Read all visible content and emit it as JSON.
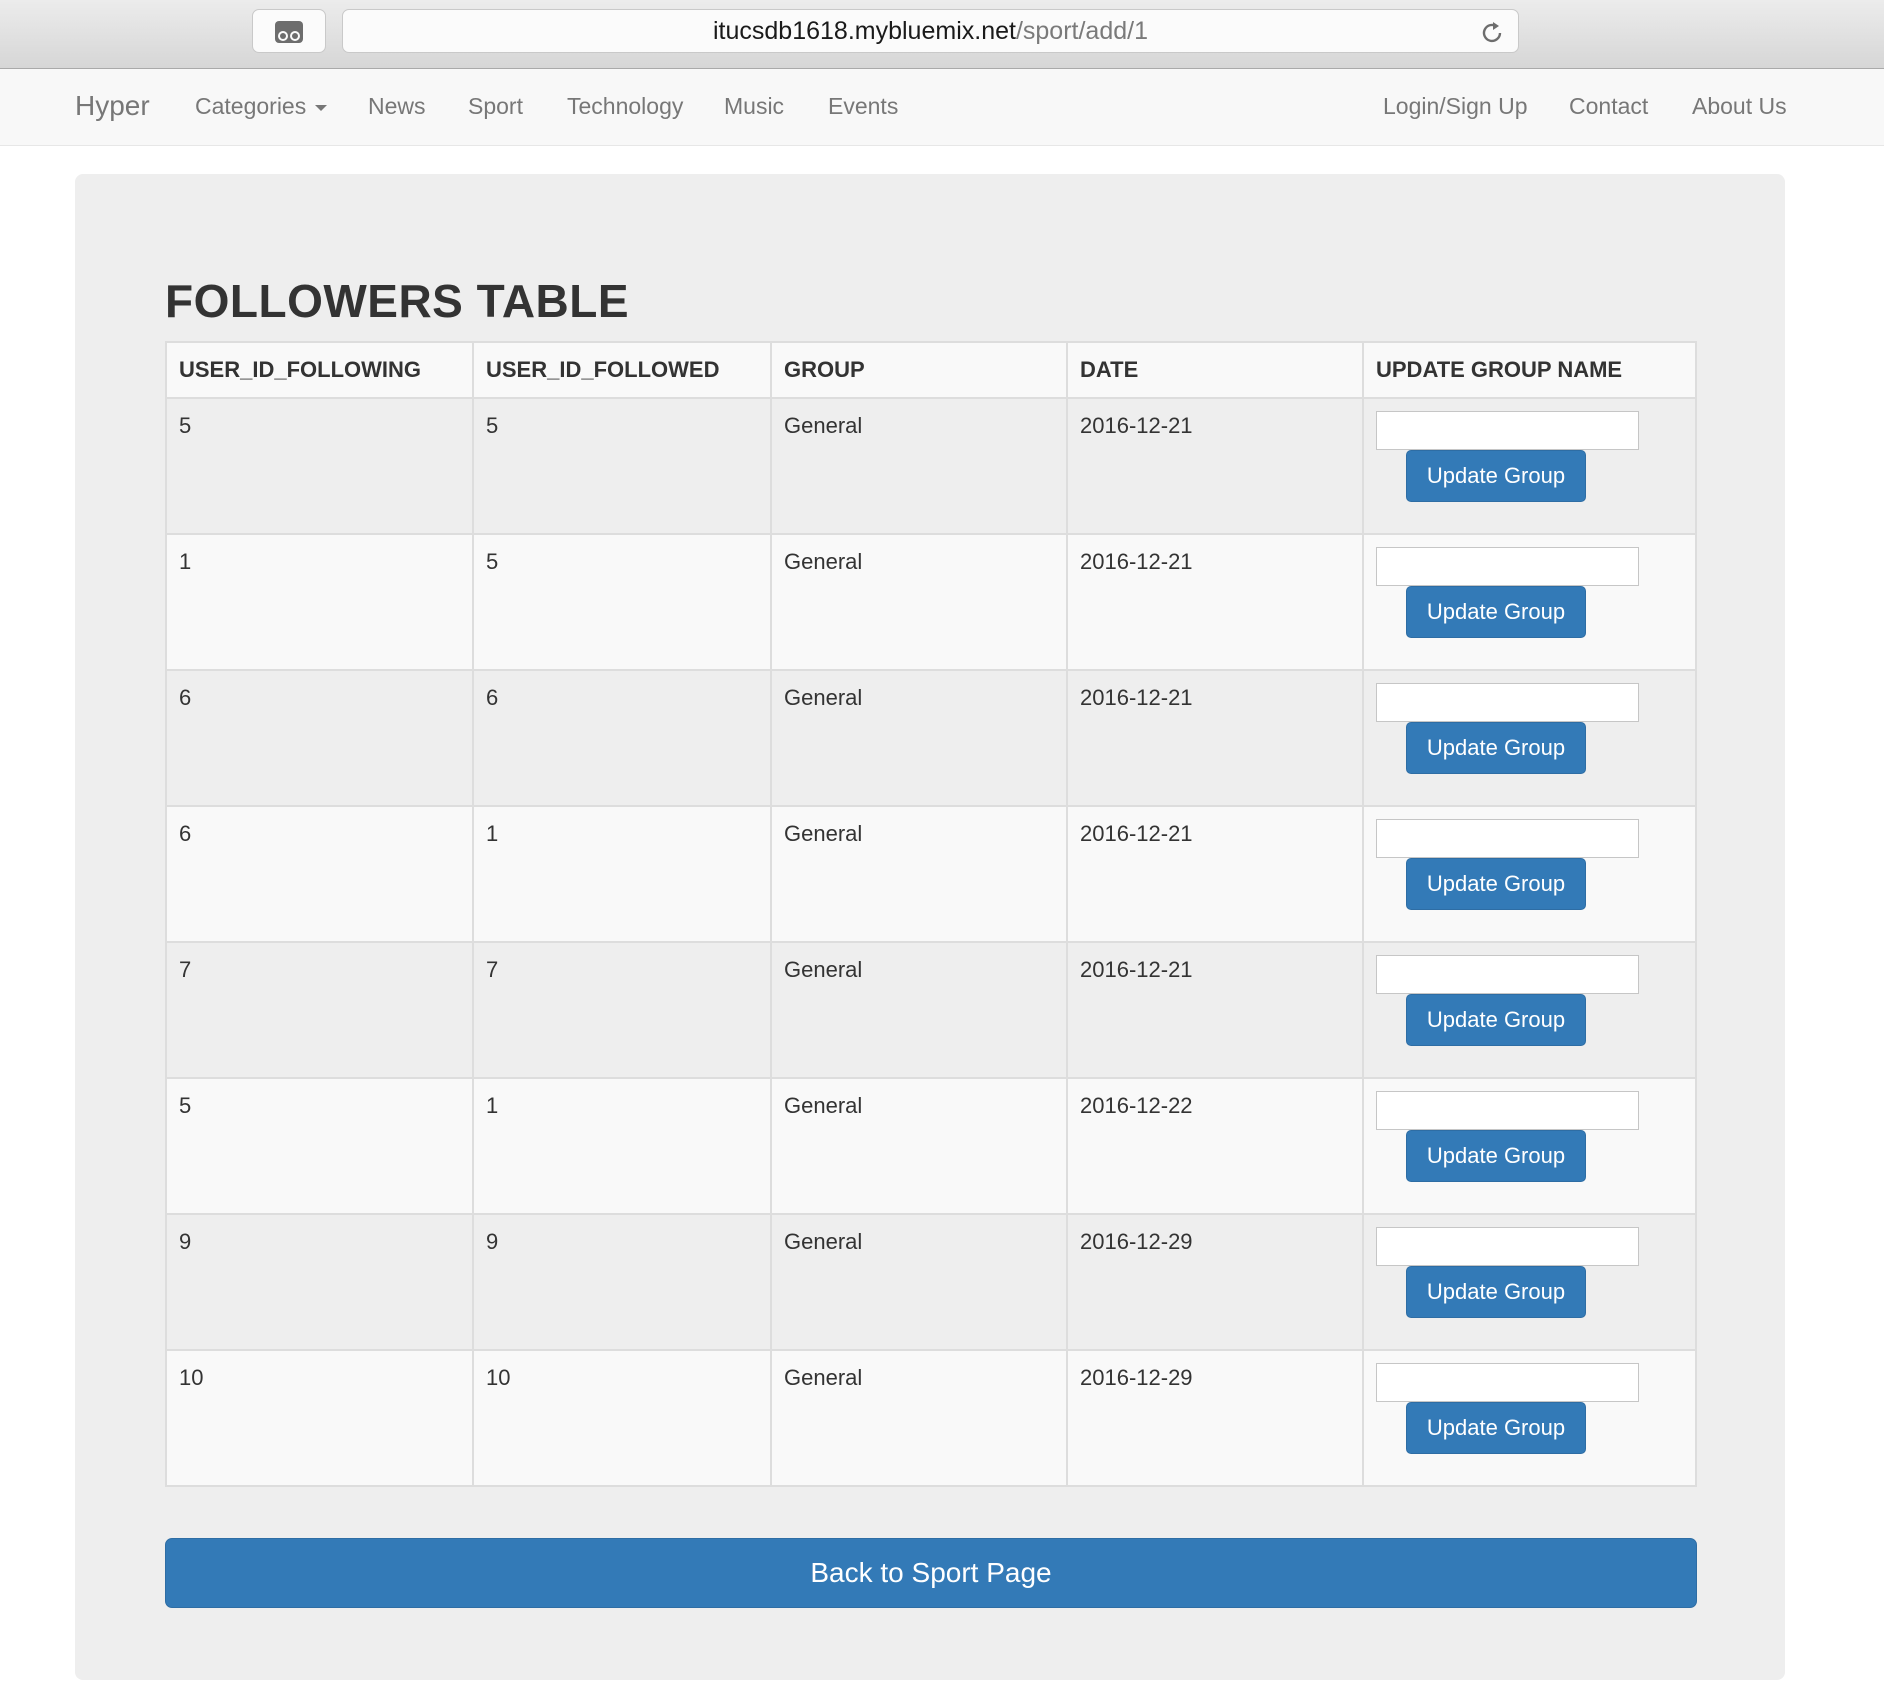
{
  "browser": {
    "url_host": "itucsdb1618.mybluemix.net",
    "url_path": "/sport/add/1"
  },
  "navbar": {
    "brand": "Hyper",
    "left_items": [
      "Categories",
      "News",
      "Sport",
      "Technology",
      "Music",
      "Events"
    ],
    "right_items": [
      "Login/Sign Up",
      "Contact",
      "About Us"
    ]
  },
  "main": {
    "title": "FOLLOWERS TABLE",
    "columns": [
      "USER_ID_FOLLOWING",
      "USER_ID_FOLLOWED",
      "GROUP",
      "DATE",
      "UPDATE GROUP NAME"
    ],
    "rows": [
      {
        "following": "5",
        "followed": "5",
        "group": "General",
        "date": "2016-12-21",
        "input_value": "",
        "button": "Update Group"
      },
      {
        "following": "1",
        "followed": "5",
        "group": "General",
        "date": "2016-12-21",
        "input_value": "",
        "button": "Update Group"
      },
      {
        "following": "6",
        "followed": "6",
        "group": "General",
        "date": "2016-12-21",
        "input_value": "",
        "button": "Update Group"
      },
      {
        "following": "6",
        "followed": "1",
        "group": "General",
        "date": "2016-12-21",
        "input_value": "",
        "button": "Update Group"
      },
      {
        "following": "7",
        "followed": "7",
        "group": "General",
        "date": "2016-12-21",
        "input_value": "",
        "button": "Update Group"
      },
      {
        "following": "5",
        "followed": "1",
        "group": "General",
        "date": "2016-12-22",
        "input_value": "",
        "button": "Update Group"
      },
      {
        "following": "9",
        "followed": "9",
        "group": "General",
        "date": "2016-12-29",
        "input_value": "",
        "button": "Update Group"
      },
      {
        "following": "10",
        "followed": "10",
        "group": "General",
        "date": "2016-12-29",
        "input_value": "",
        "button": "Update Group"
      }
    ],
    "back_button": "Back to Sport Page"
  },
  "colors": {
    "primary": "#337ab7",
    "navbar_bg": "#f8f8f8",
    "jumbotron_bg": "#eeeeee"
  }
}
